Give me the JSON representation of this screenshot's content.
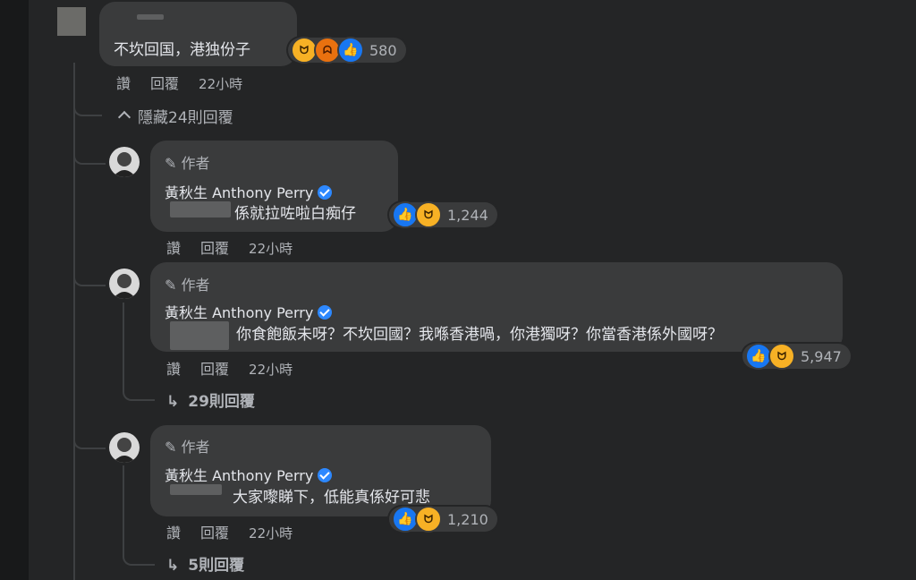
{
  "top_comment": {
    "text": "不坎回国，港独份子",
    "reaction_count": "580",
    "actions": {
      "like": "讚",
      "reply": "回覆",
      "time": "22小時"
    },
    "hide_replies": "隱藏24則回覆"
  },
  "replies": [
    {
      "author_badge": "作者",
      "author_name": "黃秋生 Anthony Perry",
      "text": "係就拉咗啦白痴仔",
      "reaction_count": "1,244",
      "actions": {
        "like": "讚",
        "reply": "回覆",
        "time": "22小時"
      }
    },
    {
      "author_badge": "作者",
      "author_name": "黃秋生 Anthony Perry",
      "text": "你食飽飯未呀？不坎回國？我喺香港喎，你港獨呀？你當香港係外國呀？",
      "reaction_count": "5,947",
      "actions": {
        "like": "讚",
        "reply": "回覆",
        "time": "22小時"
      },
      "view_replies": "29則回覆"
    },
    {
      "author_badge": "作者",
      "author_name": "黃秋生 Anthony Perry",
      "text": "大家嚟睇下，低能真係好可悲",
      "reaction_count": "1,210",
      "actions": {
        "like": "讚",
        "reply": "回覆",
        "time": "22小時"
      },
      "view_replies": "5則回覆"
    }
  ],
  "icons": {
    "like": "like-reaction-icon",
    "haha": "haha-reaction-icon",
    "angry": "angry-reaction-icon",
    "verified": "verified-badge-icon",
    "pencil": "pencil-icon",
    "chevron_up": "chevron-up-icon",
    "reply_arrow": "reply-arrow-icon"
  },
  "colors": {
    "background": "#242526",
    "bubble": "#3a3b3c",
    "like": "#1877f2",
    "verified": "#2d88ff"
  }
}
